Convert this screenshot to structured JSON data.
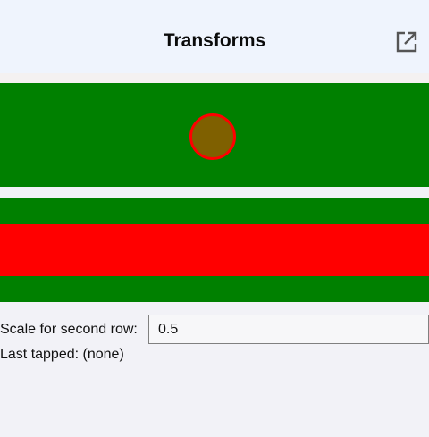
{
  "header": {
    "title": "Transforms",
    "action_icon": "open-in-new-icon"
  },
  "scale_field": {
    "label": "Scale for second row:",
    "value": "0.5"
  },
  "status": {
    "last_tapped": "Last tapped: (none)"
  },
  "colors": {
    "row_background": "#008000",
    "accent_red": "#ff0000",
    "circle_fill": "#7f6000"
  }
}
